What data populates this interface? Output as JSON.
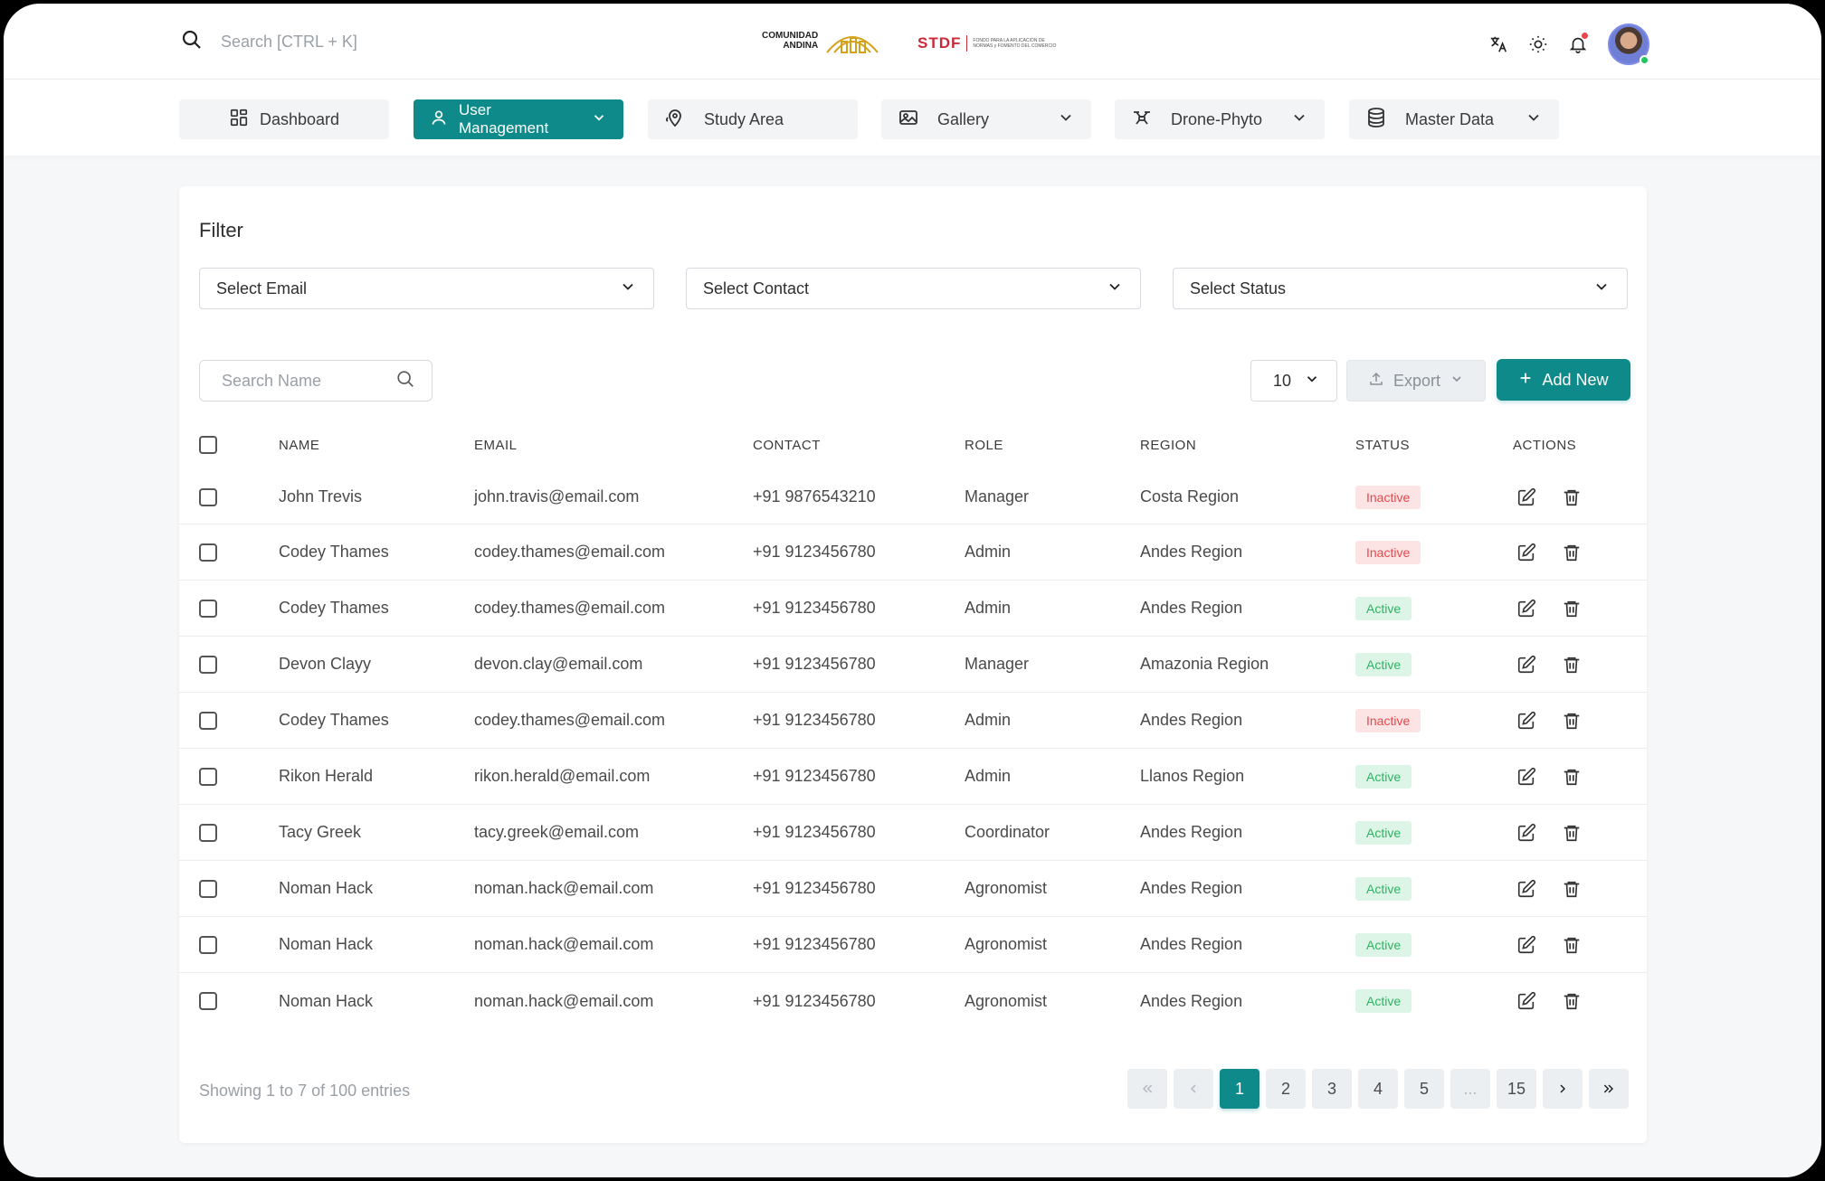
{
  "header": {
    "search_placeholder": "Search [CTRL + K]",
    "logo1_line1": "COMUNIDAD",
    "logo1_line2": "ANDINA",
    "logo2_text": "STDF",
    "logo2_sub": "FONDO PARA LA APLICACIÓN DE NORMAS y FOMENTO DEL COMERCIO"
  },
  "nav": {
    "items": [
      {
        "label": "Dashboard",
        "icon": "dashboard-icon"
      },
      {
        "label": "User Management",
        "icon": "user-icon",
        "active": true
      },
      {
        "label": "Study Area",
        "icon": "map-pin-icon"
      },
      {
        "label": "Gallery",
        "icon": "image-icon"
      },
      {
        "label": "Drone-Phyto",
        "icon": "drone-icon"
      },
      {
        "label": "Master Data",
        "icon": "database-icon"
      }
    ]
  },
  "filter": {
    "title": "Filter",
    "email": "Select Email",
    "contact": "Select Contact",
    "status": "Select Status"
  },
  "toolbar": {
    "search_placeholder": "Search Name",
    "page_size": "10",
    "export_label": "Export",
    "add_label": "Add New"
  },
  "table": {
    "headers": {
      "name": "NAME",
      "email": "EMAIL",
      "contact": "CONTACT",
      "role": "ROLE",
      "region": "REGION",
      "status": "STATUS",
      "actions": "ACTIONS"
    },
    "rows": [
      {
        "name": "John Trevis",
        "email": "john.travis@email.com",
        "contact": "+91 9876543210",
        "role": "Manager",
        "region": "Costa Region",
        "status": "Inactive"
      },
      {
        "name": "Codey Thames",
        "email": "codey.thames@email.com",
        "contact": "+91 9123456780",
        "role": "Admin",
        "region": "Andes Region",
        "status": "Inactive"
      },
      {
        "name": "Codey Thames",
        "email": "codey.thames@email.com",
        "contact": "+91 9123456780",
        "role": "Admin",
        "region": "Andes Region",
        "status": "Active"
      },
      {
        "name": "Devon Clayy",
        "email": "devon.clay@email.com",
        "contact": "+91 9123456780",
        "role": "Manager",
        "region": "Amazonia Region",
        "status": "Active"
      },
      {
        "name": "Codey Thames",
        "email": "codey.thames@email.com",
        "contact": "+91 9123456780",
        "role": "Admin",
        "region": "Andes Region",
        "status": "Inactive"
      },
      {
        "name": "Rikon Herald",
        "email": "rikon.herald@email.com",
        "contact": "+91 9123456780",
        "role": "Admin",
        "region": "Llanos Region",
        "status": "Active"
      },
      {
        "name": "Tacy Greek",
        "email": "tacy.greek@email.com",
        "contact": "+91 9123456780",
        "role": "Coordinator",
        "region": "Andes Region",
        "status": "Active"
      },
      {
        "name": "Noman Hack",
        "email": "noman.hack@email.com",
        "contact": "+91 9123456780",
        "role": "Agronomist",
        "region": "Andes Region",
        "status": "Active"
      },
      {
        "name": "Noman Hack",
        "email": "noman.hack@email.com",
        "contact": "+91 9123456780",
        "role": "Agronomist",
        "region": "Andes Region",
        "status": "Active"
      },
      {
        "name": "Noman Hack",
        "email": "noman.hack@email.com",
        "contact": "+91 9123456780",
        "role": "Agronomist",
        "region": "Andes Region",
        "status": "Active"
      }
    ]
  },
  "footer": {
    "showing": "Showing 1 to 7 of 100 entries",
    "pages": [
      "1",
      "2",
      "3",
      "4",
      "5",
      "...",
      "15"
    ],
    "current_page": "1"
  },
  "colors": {
    "primary": "#0f8a8a",
    "inactive_bg": "#fde4e4",
    "inactive_text": "#e5484d",
    "active_bg": "#dcf5e6",
    "active_text": "#2fb463"
  }
}
